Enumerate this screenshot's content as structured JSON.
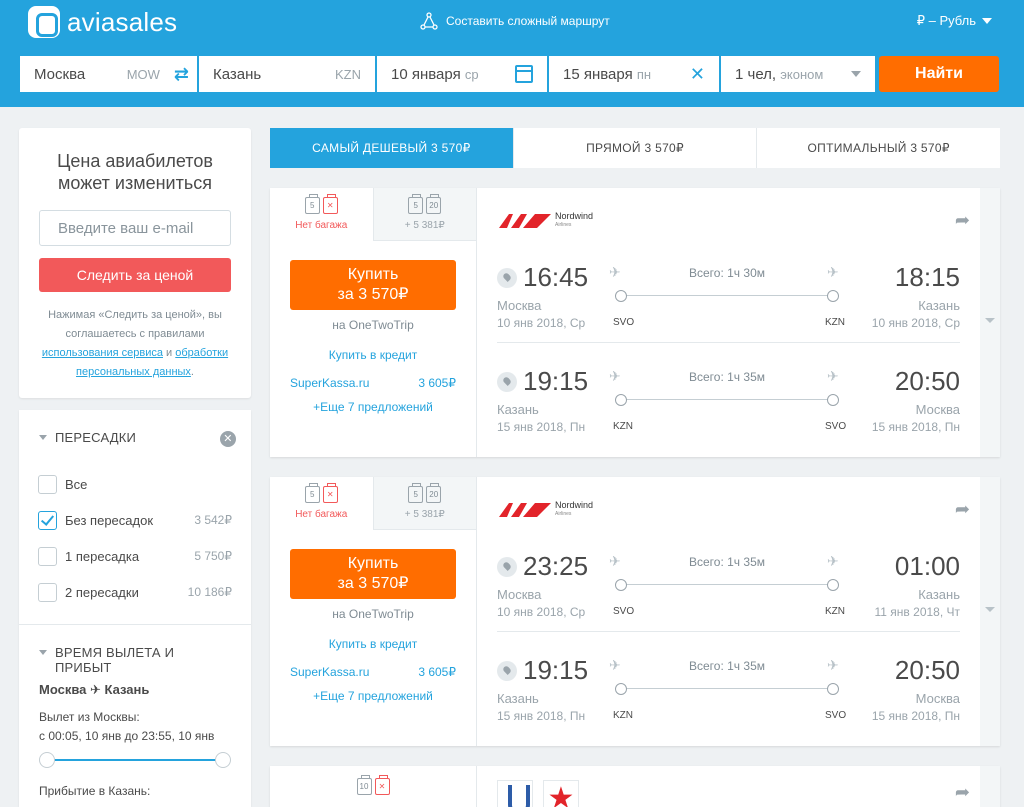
{
  "header": {
    "logo_text": "aviasales",
    "complex_route": "Составить сложный маршрут",
    "currency": "₽ – Рубль"
  },
  "search": {
    "origin": "Москва",
    "origin_code": "MOW",
    "destination": "Казань",
    "destination_code": "KZN",
    "depart_date": "10 января",
    "depart_dow": "ср",
    "return_date": "15 января",
    "return_dow": "пн",
    "passengers": "1 чел,",
    "cabin": "эконом",
    "button": "Найти"
  },
  "price_alert": {
    "title": "Цена авиабилетов может измениться",
    "email_placeholder": "Введите ваш e-mail",
    "button": "Следить за ценой",
    "disclaimer_1": "Нажимая «Следить за ценой», вы соглашаетесь с правилами",
    "link_terms": "использования сервиса",
    "and": "и",
    "link_privacy": "обработки персональных данных",
    "dot": "."
  },
  "filters": {
    "stops_title": "ПЕРЕСАДКИ",
    "stops": [
      {
        "label": "Все",
        "price": "",
        "checked": false
      },
      {
        "label": "Без пересадок",
        "price": "3 542₽",
        "checked": true
      },
      {
        "label": "1 пересадка",
        "price": "5 750₽",
        "checked": false
      },
      {
        "label": "2 пересадки",
        "price": "10 186₽",
        "checked": false
      }
    ],
    "time_title": "ВРЕМЯ ВЫЛЕТА И ПРИБЫТ",
    "route_from": "Москва",
    "route_to": "Казань",
    "depart_label": "Вылет из Москвы:",
    "depart_range": "с 00:05, 10 янв до 23:55, 10 янв",
    "arrive_label": "Прибытие в Казань:"
  },
  "tabs": [
    {
      "label": "САМЫЙ ДЕШЕВЫЙ 3 570₽",
      "active": true
    },
    {
      "label": "ПРЯМОЙ 3 570₽",
      "active": false
    },
    {
      "label": "ОПТИМАЛЬНЫЙ 3 570₽",
      "active": false
    }
  ],
  "tickets": [
    {
      "bag_a_sizes": [
        "5",
        "✕"
      ],
      "bag_a_label": "Нет багажа",
      "bag_b_sizes": [
        "5",
        "20"
      ],
      "bag_b_label": "+ 5 381₽",
      "buy_line1": "Купить",
      "buy_line2": "за 3 570₽",
      "via": "на OneTwoTrip",
      "credit": "Купить в кредит",
      "alt_agency": "SuperKassa.ru",
      "alt_price": "3 605₽",
      "more": "+Еще 7 предложений",
      "airline": "Nordwind",
      "airline_sub": "Airlines",
      "segments": [
        {
          "dep_time": "16:45",
          "arr_time": "18:15",
          "duration": "Всего: 1ч 30м",
          "dep_city": "Москва",
          "arr_city": "Казань",
          "dep_date": "10 янв 2018, Ср",
          "arr_date": "10 янв 2018, Ср",
          "dep_iata": "SVO",
          "arr_iata": "KZN"
        },
        {
          "dep_time": "19:15",
          "arr_time": "20:50",
          "duration": "Всего: 1ч 35м",
          "dep_city": "Казань",
          "arr_city": "Москва",
          "dep_date": "15 янв 2018, Пн",
          "arr_date": "15 янв 2018, Пн",
          "dep_iata": "KZN",
          "arr_iata": "SVO"
        }
      ]
    },
    {
      "bag_a_sizes": [
        "5",
        "✕"
      ],
      "bag_a_label": "Нет багажа",
      "bag_b_sizes": [
        "5",
        "20"
      ],
      "bag_b_label": "+ 5 381₽",
      "buy_line1": "Купить",
      "buy_line2": "за 3 570₽",
      "via": "на OneTwoTrip",
      "credit": "Купить в кредит",
      "alt_agency": "SuperKassa.ru",
      "alt_price": "3 605₽",
      "more": "+Еще 7 предложений",
      "airline": "Nordwind",
      "airline_sub": "Airlines",
      "segments": [
        {
          "dep_time": "23:25",
          "arr_time": "01:00",
          "duration": "Всего: 1ч 35м",
          "dep_city": "Москва",
          "arr_city": "Казань",
          "dep_date": "10 янв 2018, Ср",
          "arr_date": "11 янв 2018, Чт",
          "dep_iata": "SVO",
          "arr_iata": "KZN"
        },
        {
          "dep_time": "19:15",
          "arr_time": "20:50",
          "duration": "Всего: 1ч 35м",
          "dep_city": "Казань",
          "arr_city": "Москва",
          "dep_date": "15 янв 2018, Пн",
          "arr_date": "15 янв 2018, Пн",
          "dep_iata": "KZN",
          "arr_iata": "SVO"
        }
      ]
    },
    {
      "bag_a_sizes": [
        "10",
        "✕"
      ]
    }
  ],
  "colors": {
    "brand": "#24a3dd",
    "accent": "#ff6d00",
    "alert": "#f2595a"
  }
}
